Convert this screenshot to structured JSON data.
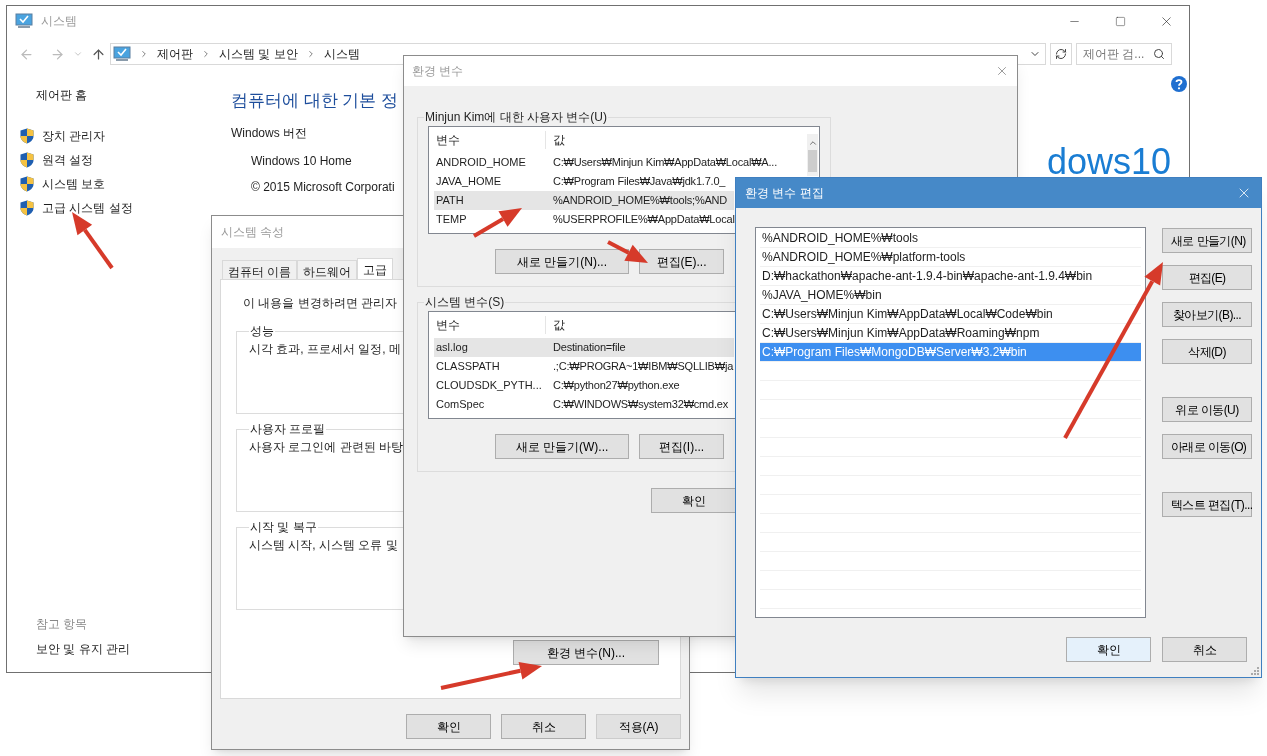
{
  "system_window": {
    "title": "시스템",
    "breadcrumb": [
      "제어판",
      "시스템 및 보안",
      "시스템"
    ],
    "search": {
      "placeholder": "제어판 검..."
    },
    "sidebar": {
      "home": "제어판 홈",
      "items": [
        "장치 관리자",
        "원격 설정",
        "시스템 보호",
        "고급 시스템 설정"
      ],
      "see_also_title": "참고 항목",
      "see_also": [
        "보안 및 유지 관리"
      ]
    },
    "heading": "컴퓨터에 대한 기본 정",
    "section": "Windows 버전",
    "edition": "Windows 10 Home",
    "copyright": "© 2015 Microsoft Corporati",
    "logo_text": "dows10"
  },
  "system_properties": {
    "title": "시스템 속성",
    "tabs": [
      {
        "label": "컴퓨터 이름",
        "selected": false
      },
      {
        "label": "하드웨어",
        "selected": false
      },
      {
        "label": "고급",
        "selected": true
      }
    ],
    "notice": "이 내용을 변경하려면 관리자",
    "groups": [
      {
        "title": "성능",
        "text": "시각 효과, 프로세서 일정, 메"
      },
      {
        "title": "사용자 프로필",
        "text": "사용자 로그인에 관련된 바탕"
      },
      {
        "title": "시작 및 복구",
        "text": "시스템 시작, 시스템 오류 및"
      }
    ],
    "env_button": "환경 변수(N)...",
    "buttons": [
      {
        "label": "확인",
        "disabled": false
      },
      {
        "label": "취소",
        "disabled": false
      },
      {
        "label": "적용(A)",
        "disabled": true
      }
    ]
  },
  "env_vars": {
    "title": "환경 변수",
    "user_group": {
      "title": "Minjun Kim에 대한 사용자 변수(U)",
      "columns": [
        "변수",
        "값"
      ],
      "rows": [
        {
          "name": "ANDROID_HOME",
          "value": "C:₩Users₩Minjun Kim₩AppData₩Local₩A...",
          "selected": false
        },
        {
          "name": "JAVA_HOME",
          "value": "C:₩Program Files₩Java₩jdk1.7.0_",
          "selected": false
        },
        {
          "name": "PATH",
          "value": "%ANDROID_HOME%₩tools;%AND",
          "selected": true
        },
        {
          "name": "TEMP",
          "value": "%USERPROFILE%₩AppData₩Local",
          "selected": false
        }
      ],
      "buttons": [
        "새로 만들기(N)...",
        "편집(E)..."
      ]
    },
    "system_group": {
      "title": "시스템 변수(S)",
      "columns": [
        "변수",
        "값"
      ],
      "rows": [
        {
          "name": "asl.log",
          "value": "Destination=file",
          "selected": true
        },
        {
          "name": "CLASSPATH",
          "value": ".;C:₩PROGRA~1₩IBM₩SQLLIB₩ja",
          "selected": false
        },
        {
          "name": "CLOUDSDK_PYTH...",
          "value": "C:₩python27₩python.exe",
          "selected": false
        },
        {
          "name": "ComSpec",
          "value": "C:₩WINDOWS₩system32₩cmd.ex",
          "selected": false
        }
      ],
      "buttons": [
        "새로 만들기(W)...",
        "편집(I)..."
      ]
    },
    "ok": "확인"
  },
  "edit_dialog": {
    "title": "환경 변수 편집",
    "entries": [
      {
        "text": "%ANDROID_HOME%₩tools",
        "selected": false
      },
      {
        "text": "%ANDROID_HOME%₩platform-tools",
        "selected": false
      },
      {
        "text": "D:₩hackathon₩apache-ant-1.9.4-bin₩apache-ant-1.9.4₩bin",
        "selected": false
      },
      {
        "text": "%JAVA_HOME%₩bin",
        "selected": false
      },
      {
        "text": "C:₩Users₩Minjun Kim₩AppData₩Local₩Code₩bin",
        "selected": false
      },
      {
        "text": "C:₩Users₩Minjun Kim₩AppData₩Roaming₩npm",
        "selected": false
      },
      {
        "text": "C:₩Program Files₩MongoDB₩Server₩3.2₩bin",
        "selected": true
      }
    ],
    "button_groups": [
      [
        "새로 만들기(N)",
        "편집(E)",
        "찾아보기(B)...",
        "삭제(D)"
      ],
      [
        "위로 이동(U)",
        "아래로 이동(O)"
      ],
      [
        "텍스트 편집(T)..."
      ]
    ],
    "ok": "확인",
    "cancel": "취소"
  }
}
